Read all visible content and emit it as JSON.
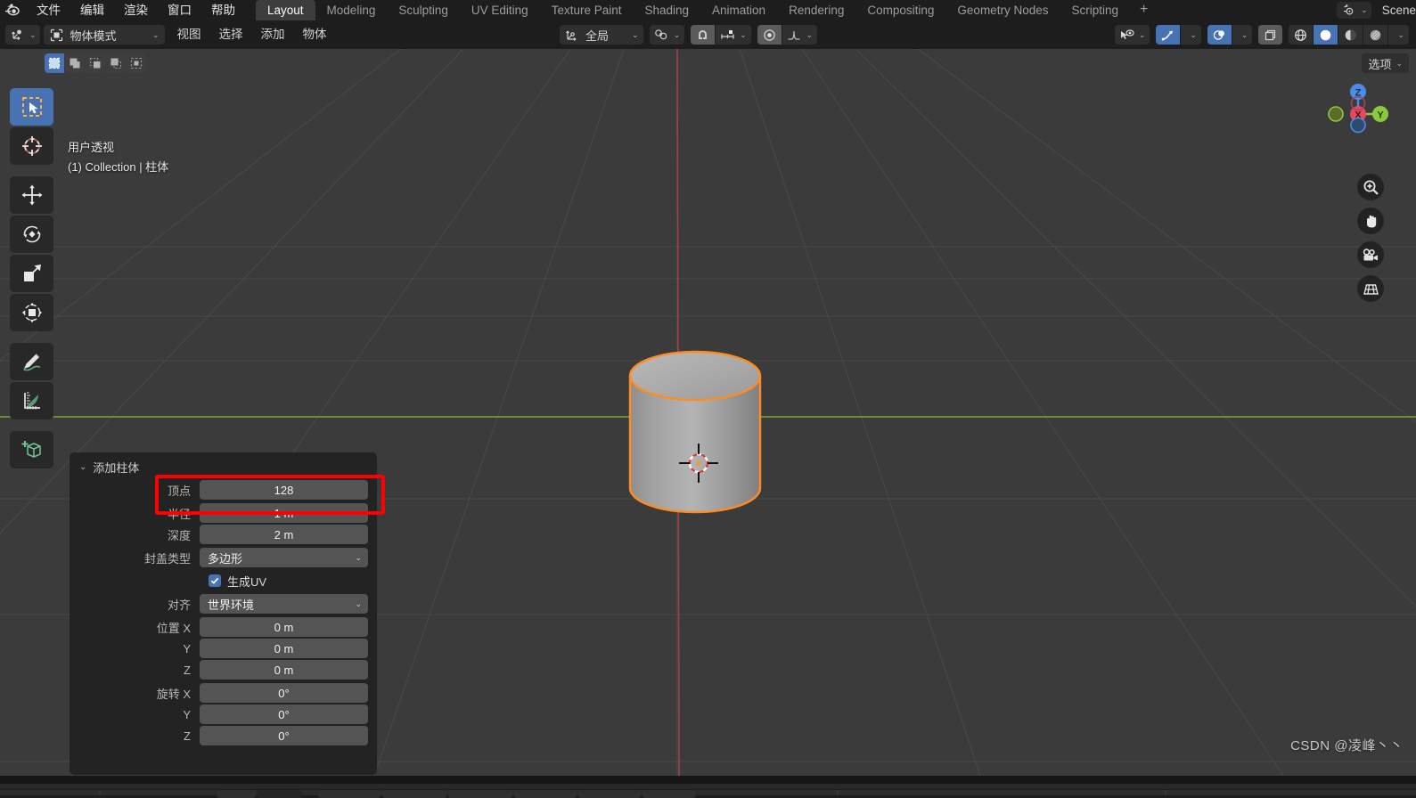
{
  "app": {
    "logo_icon": "blender-logo",
    "menus": [
      "文件",
      "编辑",
      "渲染",
      "窗口",
      "帮助"
    ],
    "workspace_tabs": [
      {
        "label": "Layout",
        "active": true
      },
      {
        "label": "Modeling",
        "active": false
      },
      {
        "label": "Sculpting",
        "active": false
      },
      {
        "label": "UV Editing",
        "active": false
      },
      {
        "label": "Texture Paint",
        "active": false
      },
      {
        "label": "Shading",
        "active": false
      },
      {
        "label": "Animation",
        "active": false
      },
      {
        "label": "Rendering",
        "active": false
      },
      {
        "label": "Compositing",
        "active": false
      },
      {
        "label": "Geometry Nodes",
        "active": false
      },
      {
        "label": "Scripting",
        "active": false
      }
    ],
    "add_workspace_label": "+",
    "scene": {
      "icon": "scene-icon",
      "name": "Scene",
      "chevron": "⌄"
    }
  },
  "viewport_header": {
    "editor_type_icon": "editor-type-3dview-icon",
    "mode_selector": {
      "icon": "object-mode-icon",
      "label": "物体模式",
      "chevron": "⌄"
    },
    "menus": [
      "视图",
      "选择",
      "添加",
      "物体"
    ],
    "transform_orientation": {
      "icon": "orientation-icon",
      "label": "全局",
      "chevron": "⌄"
    },
    "pivot": {
      "icon": "pivot-icon",
      "chevron": "⌄"
    },
    "snap_magnet": {
      "icon": "magnet-icon",
      "active": true
    },
    "snap_target": {
      "icon": "snap-increment-icon",
      "chevron": "⌄"
    },
    "proportional_edit": {
      "icon": "proportional-dot-icon",
      "active": true
    },
    "falloff": {
      "icon": "falloff-curve-icon",
      "chevron": "⌄"
    },
    "visibility": {
      "icon": "eye-cursor-icon",
      "chevron": "⌄"
    },
    "gizmo": {
      "icon": "gizmo-arrow-icon",
      "active": true,
      "chevron": "⌄"
    },
    "overlays": {
      "icon": "overlay-circles-icon",
      "active": true,
      "chevron": "⌄"
    },
    "xray": {
      "icon": "xray-squares-icon",
      "active": false
    },
    "shading_modes": [
      {
        "icon": "shading-wireframe-icon",
        "active": false
      },
      {
        "icon": "shading-solid-icon",
        "active": true
      },
      {
        "icon": "shading-material-icon",
        "active": false
      },
      {
        "icon": "shading-rendered-icon",
        "active": false
      }
    ],
    "shading_chevron": "⌄"
  },
  "viewport": {
    "select_mode_buttons": [
      {
        "icon": "select-set-icon",
        "active": true
      },
      {
        "icon": "select-extend-icon",
        "active": false
      },
      {
        "icon": "select-subtract-icon",
        "active": false
      },
      {
        "icon": "select-invert-icon",
        "active": false
      },
      {
        "icon": "select-intersect-icon",
        "active": false
      }
    ],
    "options_button": {
      "label": "选项",
      "chevron": "⌄"
    },
    "overlay_line1": "用户透视",
    "overlay_line2": "(1) Collection | 柱体",
    "toolbar": [
      {
        "icon": "tweak-select-box-icon",
        "active": true
      },
      {
        "icon": "cursor-icon",
        "active": false
      },
      {
        "icon": "move-icon",
        "active": false
      },
      {
        "icon": "rotate-icon",
        "active": false
      },
      {
        "icon": "scale-icon",
        "active": false
      },
      {
        "icon": "transform-icon",
        "active": false
      },
      {
        "icon": "annotate-icon",
        "active": false
      },
      {
        "icon": "measure-icon",
        "active": false
      },
      {
        "icon": "add-cube-icon",
        "active": false
      }
    ],
    "nav_gizmo": {
      "axes": [
        {
          "label": "Z",
          "color": "#4a8ce8"
        },
        {
          "label": "Y",
          "color": "#8cc740"
        },
        {
          "label": "X",
          "color": "#e8485f"
        }
      ]
    },
    "nav_buttons": [
      {
        "icon": "zoom-icon"
      },
      {
        "icon": "pan-hand-icon"
      },
      {
        "icon": "camera-icon"
      },
      {
        "icon": "ortho-perspective-icon"
      }
    ],
    "object": {
      "name": "柱体",
      "outline_color": "#ff8c20",
      "body_color": "#a8a8a8"
    },
    "grid": {
      "y_axis_color": "#7ba838",
      "x_axis_color": "#a63f48",
      "bg_color": "#3b3b3b"
    }
  },
  "operator_panel": {
    "collapse_icon": "chevron-down-icon",
    "title": "添加柱体",
    "highlight_color": "#ff0000",
    "fields": [
      {
        "label": "顶点",
        "value": "128",
        "type": "number",
        "highlighted": true
      },
      {
        "label": "半径",
        "value": "1 m",
        "type": "number",
        "highlighted": false
      },
      {
        "label": "深度",
        "value": "2 m",
        "type": "number",
        "highlighted": false
      },
      {
        "label": "封盖类型",
        "value": "多边形",
        "type": "dropdown",
        "chevron": "⌄"
      },
      {
        "label": "",
        "value": "生成UV",
        "type": "checkbox",
        "checked": true
      },
      {
        "label": "对齐",
        "value": "世界环境",
        "type": "dropdown",
        "chevron": "⌄"
      },
      {
        "label": "位置 X",
        "value": "0 m",
        "type": "number",
        "highlighted": false
      },
      {
        "label": "Y",
        "value": "0 m",
        "type": "number",
        "highlighted": false
      },
      {
        "label": "Z",
        "value": "0 m",
        "type": "number",
        "highlighted": false
      },
      {
        "label": "旋转 X",
        "value": "0°",
        "type": "number",
        "highlighted": false
      },
      {
        "label": "Y",
        "value": "0°",
        "type": "number",
        "highlighted": false
      },
      {
        "label": "Z",
        "value": "0°",
        "type": "number",
        "highlighted": false
      }
    ]
  },
  "watermark": "CSDN @凌峰丶丶"
}
